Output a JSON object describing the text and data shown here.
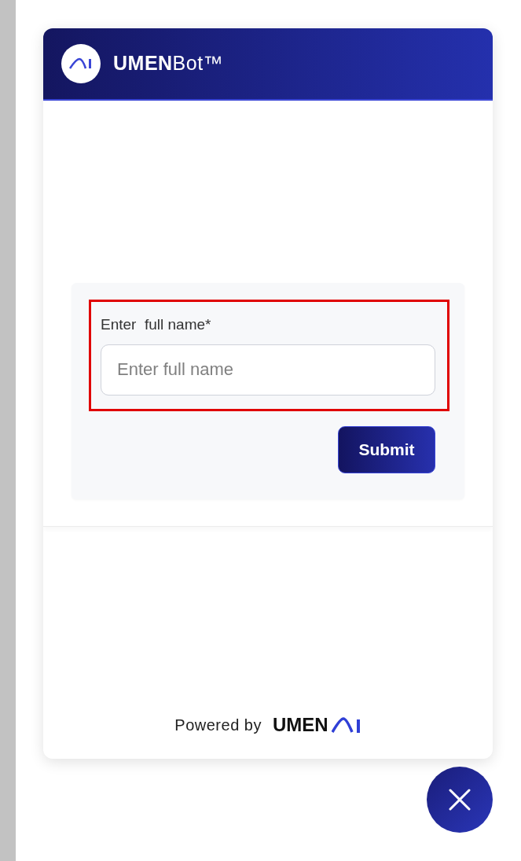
{
  "header": {
    "title": "**UMEN**Bot™"
  },
  "form": {
    "label": "Enter  full name*",
    "placeholder": "Enter full name",
    "highlighted": true,
    "submit": "Submit"
  },
  "footer": {
    "powered_by": "Powered by",
    "brand": "UMEN"
  },
  "close_button": {
    "kind": "close"
  }
}
